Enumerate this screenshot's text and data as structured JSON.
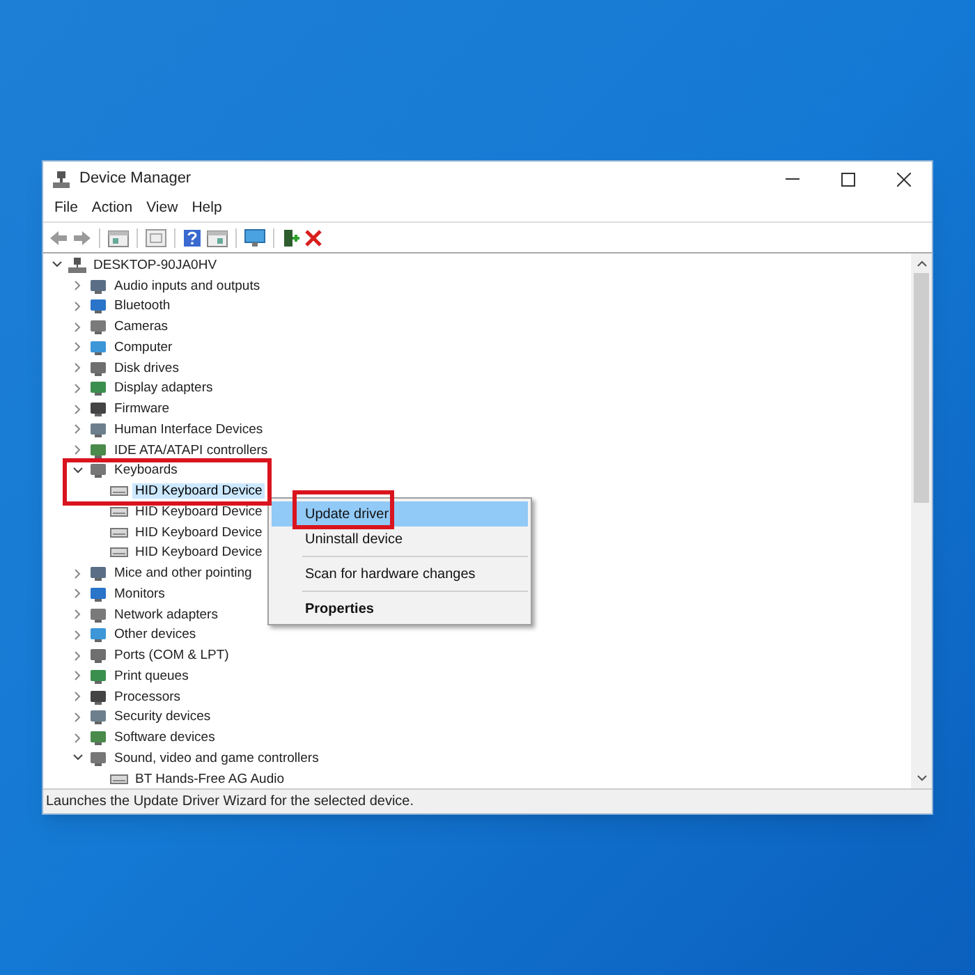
{
  "window": {
    "title": "Device Manager"
  },
  "menu_bar": [
    "File",
    "Action",
    "View",
    "Help"
  ],
  "tree": {
    "label": "DESKTOP-90JA0HV",
    "expanded": true,
    "selected": false,
    "children": [
      {
        "label": "Audio inputs and outputs",
        "expanded": false,
        "selected": false
      },
      {
        "label": "Bluetooth",
        "expanded": false,
        "selected": false
      },
      {
        "label": "Cameras",
        "expanded": false,
        "selected": false
      },
      {
        "label": "Computer",
        "expanded": false,
        "selected": false
      },
      {
        "label": "Disk drives",
        "expanded": false,
        "selected": false
      },
      {
        "label": "Display adapters",
        "expanded": false,
        "selected": false
      },
      {
        "label": "Firmware",
        "expanded": false,
        "selected": false
      },
      {
        "label": "Human Interface Devices",
        "expanded": false,
        "selected": false
      },
      {
        "label": "IDE ATA/ATAPI controllers",
        "expanded": false,
        "selected": false
      },
      {
        "label": "Keyboards",
        "expanded": true,
        "selected": false,
        "children": [
          {
            "label": "HID Keyboard Device",
            "selected": true
          },
          {
            "label": "HID Keyboard Device",
            "selected": false
          },
          {
            "label": "HID Keyboard Device",
            "selected": false
          },
          {
            "label": "HID Keyboard Device",
            "selected": false
          }
        ]
      },
      {
        "label": "Mice and other pointing",
        "expanded": false,
        "selected": false
      },
      {
        "label": "Monitors",
        "expanded": false,
        "selected": false
      },
      {
        "label": "Network adapters",
        "expanded": false,
        "selected": false
      },
      {
        "label": "Other devices",
        "expanded": false,
        "selected": false
      },
      {
        "label": "Ports (COM & LPT)",
        "expanded": false,
        "selected": false
      },
      {
        "label": "Print queues",
        "expanded": false,
        "selected": false
      },
      {
        "label": "Processors",
        "expanded": false,
        "selected": false
      },
      {
        "label": "Security devices",
        "expanded": false,
        "selected": false
      },
      {
        "label": "Software devices",
        "expanded": false,
        "selected": false
      },
      {
        "label": "Sound, video and game controllers",
        "expanded": true,
        "selected": false,
        "children": [
          {
            "label": "BT Hands-Free AG Audio",
            "selected": false
          }
        ]
      }
    ]
  },
  "context_menu": [
    {
      "kind": "item",
      "label": "Update driver",
      "selected": true,
      "default": false
    },
    {
      "kind": "item",
      "label": "Uninstall device",
      "selected": false,
      "default": false
    },
    {
      "kind": "separator"
    },
    {
      "kind": "item",
      "label": "Scan for hardware changes",
      "selected": false,
      "default": false
    },
    {
      "kind": "separator"
    },
    {
      "kind": "item",
      "label": "Properties",
      "selected": false,
      "default": true
    }
  ],
  "status_bar": "Launches the Update Driver Wizard for the selected device."
}
